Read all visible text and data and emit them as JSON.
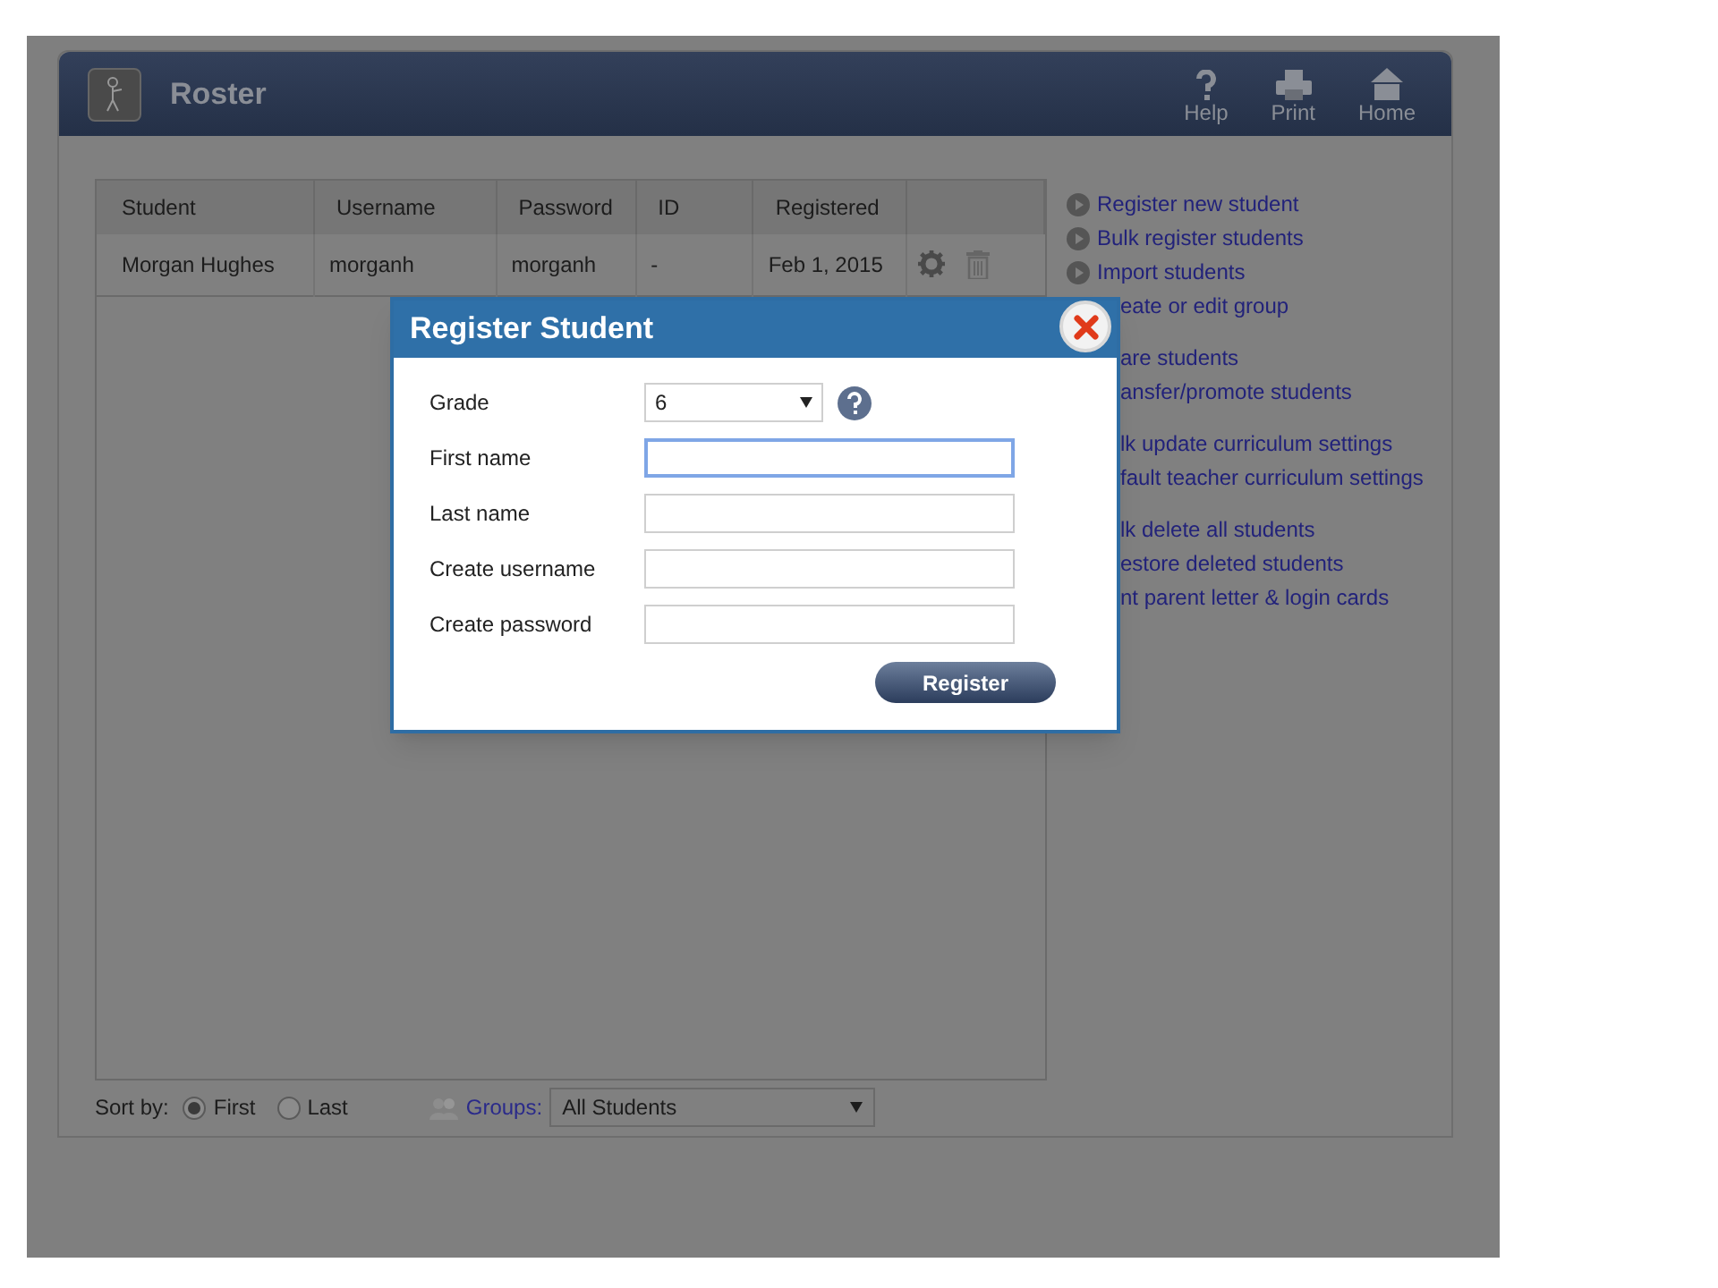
{
  "header": {
    "title": "Roster",
    "buttons": [
      {
        "kind": "help",
        "label": "Help"
      },
      {
        "kind": "print",
        "label": "Print"
      },
      {
        "kind": "home",
        "label": "Home"
      }
    ]
  },
  "table": {
    "columns": [
      "Student",
      "Username",
      "Password",
      "ID",
      "Registered"
    ],
    "rows": [
      {
        "cells": [
          "Morgan Hughes",
          "morganh",
          "morganh",
          "-",
          "Feb 1, 2015"
        ]
      }
    ]
  },
  "sidebar": [
    [
      {
        "label": "Register new student",
        "covered": false
      },
      {
        "label": "Bulk register students",
        "covered": false
      },
      {
        "label": "Import students",
        "covered": false
      },
      {
        "label": "eate or edit group",
        "covered": true
      }
    ],
    [
      {
        "label": "are students",
        "covered": true
      },
      {
        "label": "ansfer/promote students",
        "covered": true
      }
    ],
    [
      {
        "label": "lk update curriculum settings",
        "covered": true
      },
      {
        "label": "fault teacher curriculum settings",
        "covered": true
      }
    ],
    [
      {
        "label": "lk delete all students",
        "covered": true
      },
      {
        "label": "estore deleted students",
        "covered": true
      },
      {
        "label": "nt parent letter & login cards",
        "covered": true
      }
    ]
  ],
  "sort": {
    "label": "Sort by:",
    "options": [
      {
        "label": "First",
        "selected": true
      },
      {
        "label": "Last",
        "selected": false
      }
    ]
  },
  "groups": {
    "label": "Groups:",
    "value": "All Students"
  },
  "dialog": {
    "title": "Register Student",
    "fields": [
      {
        "kind": "select",
        "label": "Grade",
        "value": "6",
        "focused": false
      },
      {
        "kind": "text",
        "label": "First name",
        "focused": true
      },
      {
        "kind": "text",
        "label": "Last name",
        "focused": false
      },
      {
        "kind": "text",
        "label": "Create username",
        "focused": false
      },
      {
        "kind": "text",
        "label": "Create password",
        "focused": false
      }
    ],
    "button": "Register"
  }
}
